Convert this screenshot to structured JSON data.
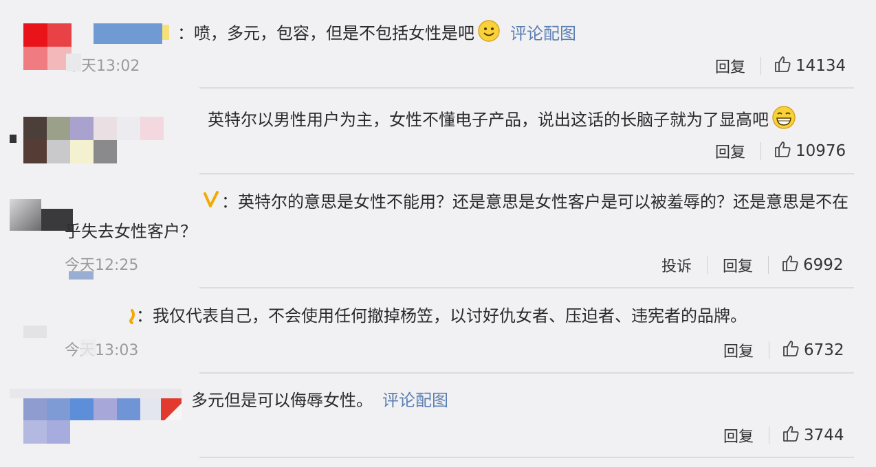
{
  "comments": [
    {
      "text_prefix": "：喷，多元，包容，但是不包括女性是吧",
      "link": "评论配图",
      "time": "今天13:02",
      "reply": "回复",
      "likes": "14134"
    },
    {
      "text_prefix": "英特尔以男性用户为主，女性不懂电子产品，说出这话的长脑子就为了显高吧",
      "reply": "回复",
      "likes": "10976"
    },
    {
      "text_line1": "：英特尔的意思是女性不能用？还是意思是女性客户是可以被羞辱的？还是意思是不在",
      "text_line2": "乎失去女性客户？",
      "time": "今天12:25",
      "report": "投诉",
      "reply": "回复",
      "likes": "6992"
    },
    {
      "text_prefix": "：我仅代表自己，不会使用任何撤掉杨笠，以讨好仇女者、压迫者、违宪者的品牌。",
      "time": "今天13:03",
      "reply": "回复",
      "likes": "6732"
    },
    {
      "text_prefix": "多元但是可以侮辱女性。",
      "link": "评论配图",
      "reply": "回复",
      "likes": "3744"
    }
  ],
  "icons": {
    "like": "thumbs-up-icon",
    "emoji_smile": "smile-emoji-icon",
    "emoji_grin": "grin-emoji-icon",
    "verify": "verified-v-icon"
  },
  "colors": {
    "link": "#5b7fb1",
    "timestamp": "#9a9a9a",
    "emoji": "#f5c518",
    "verify": "#f2a900"
  }
}
